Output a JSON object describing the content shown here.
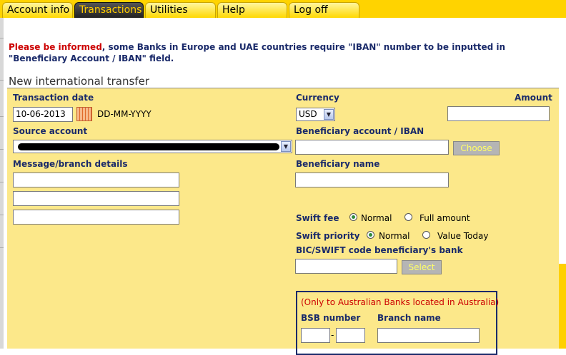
{
  "tabs": [
    {
      "label": "Account info",
      "active": false
    },
    {
      "label": "Transactions",
      "active": true
    },
    {
      "label": "Utilities",
      "active": false
    },
    {
      "label": "Help",
      "active": false
    },
    {
      "label": "Log off",
      "active": false
    }
  ],
  "notice": {
    "emphasis": "Please be informed",
    "text": ", some Banks in Europe and UAE countries require \"IBAN\" number to be inputted in \"Beneficiary Account / IBAN\" field."
  },
  "section_title": "New international transfer",
  "form": {
    "transaction_date_label": "Transaction date",
    "transaction_date_value": "10-06-2013",
    "date_format": "DD-MM-YYYY",
    "currency_label": "Currency",
    "currency_value": "USD",
    "amount_label": "Amount",
    "amount_value": "",
    "source_account_label": "Source account",
    "source_account_value": "",
    "beneficiary_account_label": "Beneficiary account / IBAN",
    "beneficiary_account_value": "",
    "choose_button": "Choose",
    "message_label": "Message/branch details",
    "beneficiary_name_label": "Beneficiary name",
    "swift_fee_label": "Swift fee",
    "swift_fee_options": [
      "Normal",
      "Full amount"
    ],
    "swift_fee_selected": "Normal",
    "swift_priority_label": "Swift priority",
    "swift_priority_options": [
      "Normal",
      "Value Today"
    ],
    "swift_priority_selected": "Normal",
    "bic_label": "BIC/SWIFT code beneficiary's bank",
    "select_button": "Select",
    "australia_note": "(Only to Australian Banks located in Australia)",
    "bsb_label": "BSB number",
    "branch_label": "Branch name"
  },
  "colors": {
    "topbar": "#ffd300",
    "panel": "#fce88a",
    "label": "#1a2a6a",
    "notice_red": "#cc0000"
  }
}
